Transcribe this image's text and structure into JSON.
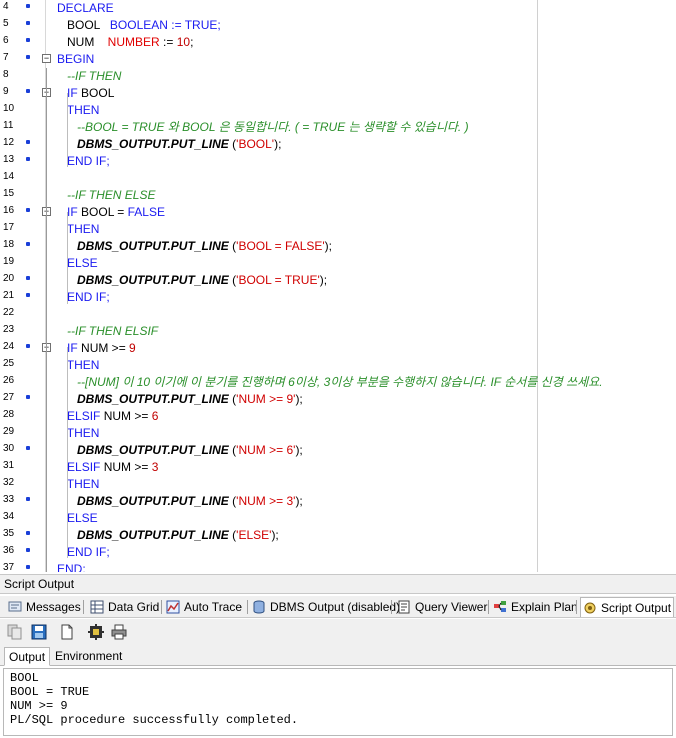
{
  "editor": {
    "lines": [
      {
        "n": "4",
        "dot": true,
        "fold": false,
        "segs": [
          [
            "kw",
            "DECLARE"
          ]
        ]
      },
      {
        "n": "5",
        "dot": true,
        "fold": false,
        "segs": [
          [
            "plain",
            "   BOOL   "
          ],
          [
            "kw",
            "BOOLEAN := TRUE;"
          ]
        ]
      },
      {
        "n": "6",
        "dot": true,
        "fold": false,
        "segs": [
          [
            "plain",
            "   NUM    "
          ],
          [
            "red",
            "NUMBER"
          ],
          [
            "plain",
            " := "
          ],
          [
            "num",
            "10"
          ],
          [
            "plain",
            ";"
          ]
        ]
      },
      {
        "n": "7",
        "dot": true,
        "fold": true,
        "segs": [
          [
            "kw",
            "BEGIN"
          ]
        ]
      },
      {
        "n": "8",
        "dot": false,
        "fold": false,
        "segs": [
          [
            "cmt",
            "   --IF THEN"
          ]
        ]
      },
      {
        "n": "9",
        "dot": true,
        "fold": true,
        "segs": [
          [
            "plain",
            "   "
          ],
          [
            "kw",
            "IF"
          ],
          [
            "plain",
            " BOOL"
          ]
        ]
      },
      {
        "n": "10",
        "dot": false,
        "fold": false,
        "segs": [
          [
            "kw",
            "   THEN"
          ]
        ]
      },
      {
        "n": "11",
        "dot": false,
        "fold": false,
        "segs": [
          [
            "cmt",
            "      --BOOL = TRUE 와 BOOL 은 동일합니다. ( = TRUE 는 생략할 수 있습니다. )"
          ]
        ]
      },
      {
        "n": "12",
        "dot": true,
        "fold": false,
        "segs": [
          [
            "plain",
            "      "
          ],
          [
            "fn",
            "DBMS_OUTPUT.PUT_LINE"
          ],
          [
            "plain",
            " ("
          ],
          [
            "str",
            "'BOOL'"
          ],
          [
            "plain",
            ");"
          ]
        ]
      },
      {
        "n": "13",
        "dot": true,
        "fold": false,
        "segs": [
          [
            "plain",
            "   "
          ],
          [
            "kw",
            "END IF;"
          ]
        ]
      },
      {
        "n": "14",
        "dot": false,
        "fold": false,
        "segs": []
      },
      {
        "n": "15",
        "dot": false,
        "fold": false,
        "segs": [
          [
            "cmt",
            "   --IF THEN ELSE"
          ]
        ]
      },
      {
        "n": "16",
        "dot": true,
        "fold": true,
        "segs": [
          [
            "plain",
            "   "
          ],
          [
            "kw",
            "IF"
          ],
          [
            "plain",
            " BOOL = "
          ],
          [
            "kw",
            "FALSE"
          ]
        ]
      },
      {
        "n": "17",
        "dot": false,
        "fold": false,
        "segs": [
          [
            "kw",
            "   THEN"
          ]
        ]
      },
      {
        "n": "18",
        "dot": true,
        "fold": false,
        "segs": [
          [
            "plain",
            "      "
          ],
          [
            "fn",
            "DBMS_OUTPUT.PUT_LINE"
          ],
          [
            "plain",
            " ("
          ],
          [
            "str",
            "'BOOL = FALSE'"
          ],
          [
            "plain",
            ");"
          ]
        ]
      },
      {
        "n": "19",
        "dot": false,
        "fold": false,
        "segs": [
          [
            "kw",
            "   ELSE"
          ]
        ]
      },
      {
        "n": "20",
        "dot": true,
        "fold": false,
        "segs": [
          [
            "plain",
            "      "
          ],
          [
            "fn",
            "DBMS_OUTPUT.PUT_LINE"
          ],
          [
            "plain",
            " ("
          ],
          [
            "str",
            "'BOOL = TRUE'"
          ],
          [
            "plain",
            ");"
          ]
        ]
      },
      {
        "n": "21",
        "dot": true,
        "fold": false,
        "segs": [
          [
            "plain",
            "   "
          ],
          [
            "kw",
            "END IF;"
          ]
        ]
      },
      {
        "n": "22",
        "dot": false,
        "fold": false,
        "segs": []
      },
      {
        "n": "23",
        "dot": false,
        "fold": false,
        "segs": [
          [
            "cmt",
            "   --IF THEN ELSIF"
          ]
        ]
      },
      {
        "n": "24",
        "dot": true,
        "fold": true,
        "segs": [
          [
            "plain",
            "   "
          ],
          [
            "kw",
            "IF"
          ],
          [
            "plain",
            " NUM >= "
          ],
          [
            "num",
            "9"
          ]
        ]
      },
      {
        "n": "25",
        "dot": false,
        "fold": false,
        "segs": [
          [
            "kw",
            "   THEN"
          ]
        ]
      },
      {
        "n": "26",
        "dot": false,
        "fold": false,
        "segs": [
          [
            "cmt",
            "      --[NUM] 이 10 이기에 이 분기를 진행하며 6이상, 3이상 부분을 수행하지 않습니다. IF 순서를 신경 쓰세요."
          ]
        ]
      },
      {
        "n": "27",
        "dot": true,
        "fold": false,
        "segs": [
          [
            "plain",
            "      "
          ],
          [
            "fn",
            "DBMS_OUTPUT.PUT_LINE"
          ],
          [
            "plain",
            " ("
          ],
          [
            "str",
            "'NUM >= 9'"
          ],
          [
            "plain",
            ");"
          ]
        ]
      },
      {
        "n": "28",
        "dot": false,
        "fold": false,
        "segs": [
          [
            "plain",
            "   "
          ],
          [
            "kw",
            "ELSIF"
          ],
          [
            "plain",
            " NUM >= "
          ],
          [
            "num",
            "6"
          ]
        ]
      },
      {
        "n": "29",
        "dot": false,
        "fold": false,
        "segs": [
          [
            "kw",
            "   THEN"
          ]
        ]
      },
      {
        "n": "30",
        "dot": true,
        "fold": false,
        "segs": [
          [
            "plain",
            "      "
          ],
          [
            "fn",
            "DBMS_OUTPUT.PUT_LINE"
          ],
          [
            "plain",
            " ("
          ],
          [
            "str",
            "'NUM >= 6'"
          ],
          [
            "plain",
            ");"
          ]
        ]
      },
      {
        "n": "31",
        "dot": false,
        "fold": false,
        "segs": [
          [
            "plain",
            "   "
          ],
          [
            "kw",
            "ELSIF"
          ],
          [
            "plain",
            " NUM >= "
          ],
          [
            "num",
            "3"
          ]
        ]
      },
      {
        "n": "32",
        "dot": false,
        "fold": false,
        "segs": [
          [
            "kw",
            "   THEN"
          ]
        ]
      },
      {
        "n": "33",
        "dot": true,
        "fold": false,
        "segs": [
          [
            "plain",
            "      "
          ],
          [
            "fn",
            "DBMS_OUTPUT.PUT_LINE"
          ],
          [
            "plain",
            " ("
          ],
          [
            "str",
            "'NUM >= 3'"
          ],
          [
            "plain",
            ");"
          ]
        ]
      },
      {
        "n": "34",
        "dot": false,
        "fold": false,
        "segs": [
          [
            "kw",
            "   ELSE"
          ]
        ]
      },
      {
        "n": "35",
        "dot": true,
        "fold": false,
        "segs": [
          [
            "plain",
            "      "
          ],
          [
            "fn",
            "DBMS_OUTPUT.PUT_LINE"
          ],
          [
            "plain",
            " ("
          ],
          [
            "str",
            "'ELSE'"
          ],
          [
            "plain",
            ");"
          ]
        ]
      },
      {
        "n": "36",
        "dot": true,
        "fold": false,
        "segs": [
          [
            "plain",
            "   "
          ],
          [
            "kw",
            "END IF;"
          ]
        ]
      },
      {
        "n": "37",
        "dot": true,
        "fold": false,
        "segs": [
          [
            "kw",
            "END;"
          ]
        ]
      }
    ]
  },
  "panel": {
    "title": "Script Output",
    "tabs": [
      {
        "label": "Messages",
        "icon": "messages-icon"
      },
      {
        "label": "Data Grid",
        "icon": "data-grid-icon"
      },
      {
        "label": "Auto Trace",
        "icon": "auto-trace-icon"
      },
      {
        "label": "DBMS Output (disabled)",
        "icon": "dbms-output-icon"
      },
      {
        "label": "Query Viewer",
        "icon": "query-viewer-icon"
      },
      {
        "label": "Explain Plan",
        "icon": "explain-plan-icon"
      },
      {
        "label": "Script Output",
        "icon": "script-output-icon"
      }
    ],
    "toolbar_icons": [
      "copy-icon",
      "save-icon",
      "new-document-icon",
      "settings-icon",
      "print-icon"
    ],
    "subtabs": [
      "Output",
      "Environment"
    ],
    "output_lines": [
      "BOOL",
      "BOOL = TRUE",
      "NUM >= 9",
      "PL/SQL procedure successfully completed."
    ]
  }
}
